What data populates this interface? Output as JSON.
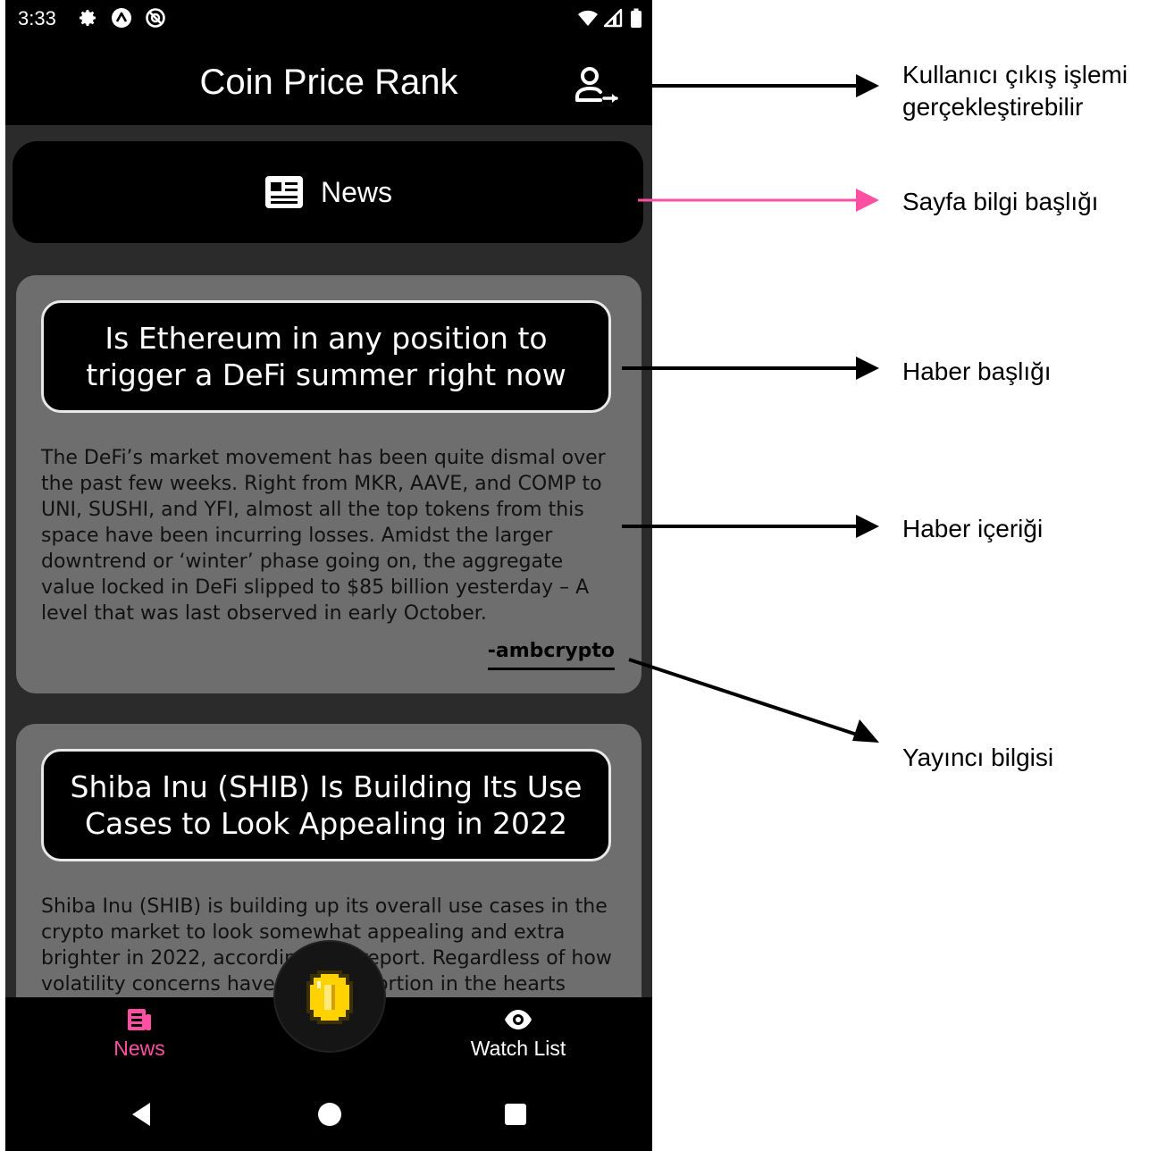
{
  "status_bar": {
    "time": "3:33",
    "icons": [
      "gear-icon",
      "android-icon",
      "no-sim-icon",
      "wifi-icon",
      "signal-icon",
      "battery-icon"
    ]
  },
  "app_bar": {
    "title": "Coin Price Rank",
    "logout_icon": "logout-user-icon"
  },
  "page_header": {
    "label": "News",
    "icon": "newspaper-icon"
  },
  "news": [
    {
      "title": "Is Ethereum in any position to trigger a DeFi summer right now",
      "body": "The DeFi’s market movement has been quite dismal over the past few weeks. Right from MKR, AAVE, and COMP to UNI, SUSHI, and YFI, almost all the top tokens from this space have been incurring losses.  Amidst the larger downtrend or ‘winter’ phase going on, the aggregate value locked in DeFi slipped to $85 billion yesterday – A level that was last observed in early October.",
      "source": "-ambcrypto"
    },
    {
      "title": "Shiba Inu (SHIB) Is Building Its Use Cases to Look Appealing in 2022",
      "body": "Shiba Inu (SHIB) is building up its overall use cases in the crypto market to look somewhat appealing and extra brighter in 2022, according to a report.  Regardless of how volatility concerns have a larger portion in the hearts"
    }
  ],
  "bottom_nav": {
    "items": [
      {
        "label": "News",
        "icon": "newspaper-icon",
        "active": true
      },
      {
        "label": "Watch List",
        "icon": "eye-icon",
        "active": false
      }
    ],
    "fab_icon": "coin-icon"
  },
  "system_nav": [
    "back-icon",
    "home-icon",
    "recents-icon"
  ],
  "annotations": [
    {
      "text": "Kullanıcı çıkış işlemi gerçekleştirebilir"
    },
    {
      "text": "Sayfa bilgi başlığı"
    },
    {
      "text": "Haber başlığı"
    },
    {
      "text": "Haber içeriği"
    },
    {
      "text": "Yayıncı bilgisi"
    }
  ],
  "colors": {
    "accent": "#ff4fa3",
    "app_bar": "#000000",
    "background": "#2b2b2b",
    "card": "#6e6e6e"
  }
}
